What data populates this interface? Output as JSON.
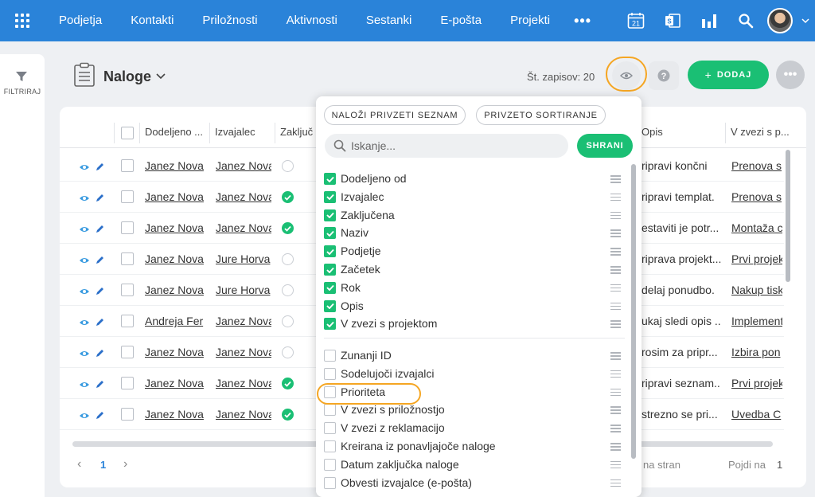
{
  "nav": {
    "items": [
      "Podjetja",
      "Kontakti",
      "Priložnosti",
      "Aktivnosti",
      "Sestanki",
      "E-pošta",
      "Projekti"
    ],
    "more": "•••",
    "calendar_day": "21",
    "icons": [
      "calendar-icon",
      "outlook-icon",
      "chart-icon",
      "search-icon",
      "avatar",
      "chevron-down-icon"
    ]
  },
  "sidebar": {
    "filter_label": "FILTRIRAJ"
  },
  "header": {
    "title": "Naloge",
    "record_count": "Št. zapisov: 20",
    "add_label": "DODAJ",
    "add_plus": "+"
  },
  "table": {
    "columns": [
      "Dodeljeno ...",
      "Izvajalec",
      "Zaključ",
      "Opis",
      "V zvezi s p..."
    ],
    "rows": [
      {
        "assigned": "Janez Nova",
        "executor": "Janez Nova",
        "done": false,
        "desc": "ripravi končni",
        "related": "Prenova s"
      },
      {
        "assigned": "Janez Nova",
        "executor": "Janez Nova",
        "done": true,
        "desc": "ripravi templat.",
        "related": "Prenova s"
      },
      {
        "assigned": "Janez Nova",
        "executor": "Janez Nova",
        "done": true,
        "desc": "estaviti je potr...",
        "related": "Montaža c"
      },
      {
        "assigned": "Janez Nova",
        "executor": "Jure Horva",
        "done": false,
        "desc": "riprava projekt...",
        "related": "Prvi projek"
      },
      {
        "assigned": "Janez Nova",
        "executor": "Jure Horva",
        "done": false,
        "desc": "delaj ponudbo.",
        "related": "Nakup tisk"
      },
      {
        "assigned": "Andreja Fer",
        "executor": "Janez Nova",
        "done": false,
        "desc": "ukaj sledi opis ...",
        "related": "Implement"
      },
      {
        "assigned": "Janez Nova",
        "executor": "Janez Nova",
        "done": false,
        "desc": "rosim za pripr...",
        "related": "Izbira pon"
      },
      {
        "assigned": "Janez Nova",
        "executor": "Janez Nova",
        "done": true,
        "desc": "ripravi seznam...",
        "related": "Prvi projek"
      },
      {
        "assigned": "Janez Nova",
        "executor": "Janez Nova",
        "done": true,
        "desc": "strezno se pri...",
        "related": "Uvedba C"
      }
    ],
    "pager": {
      "prev": "‹",
      "current_page": "1",
      "next": "›",
      "per_page_label": "na stran",
      "goto_label": "Pojdi na",
      "goto_value": "1"
    }
  },
  "column_panel": {
    "load_list_label": "NALOŽI PRIVZETI SEZNAM",
    "default_sort_label": "PRIVZETO SORTIRANJE",
    "search_placeholder": "Iskanje...",
    "save_label": "SHRANI",
    "checked": [
      "Dodeljeno od",
      "Izvajalec",
      "Zaključena",
      "Naziv",
      "Podjetje",
      "Začetek",
      "Rok",
      "Opis",
      "V zvezi s projektom"
    ],
    "unchecked": [
      "Zunanji ID",
      "Sodelujoči izvajalci",
      "Prioriteta",
      "V zvezi s priložnostjo",
      "V zvezi z reklamacijo",
      "Kreirana iz ponavljajoče naloge",
      "Datum zaključka naloge",
      "Obvesti izvajalce (e-pošta)"
    ]
  },
  "colors": {
    "nav": "#2a83d9",
    "accent_green": "#1abf74",
    "highlight": "#f5a623",
    "eye_blue": "#3a9be0"
  }
}
